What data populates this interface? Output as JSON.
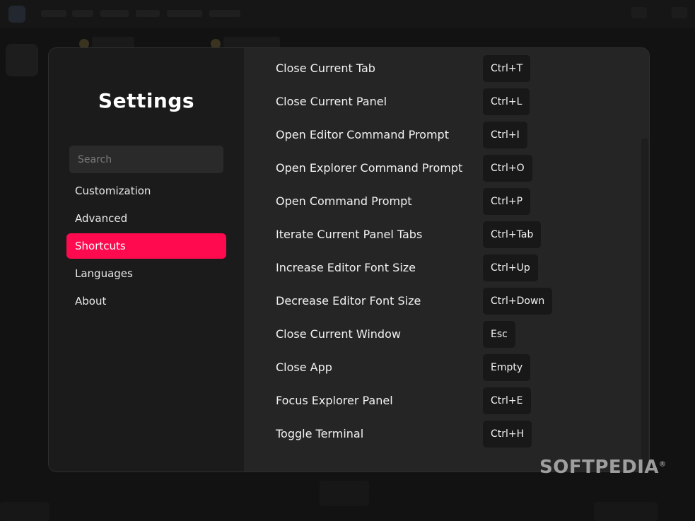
{
  "sidebar": {
    "title": "Settings",
    "search_placeholder": "Search",
    "items": [
      {
        "label": "Customization",
        "active": false
      },
      {
        "label": "Advanced",
        "active": false
      },
      {
        "label": "Shortcuts",
        "active": true
      },
      {
        "label": "Languages",
        "active": false
      },
      {
        "label": "About",
        "active": false
      }
    ]
  },
  "shortcuts": [
    {
      "label": "Close Current Tab",
      "key": "Ctrl+T"
    },
    {
      "label": "Close Current Panel",
      "key": "Ctrl+L"
    },
    {
      "label": "Open Editor Command Prompt",
      "key": "Ctrl+I"
    },
    {
      "label": "Open Explorer Command Prompt",
      "key": "Ctrl+O"
    },
    {
      "label": "Open Command Prompt",
      "key": "Ctrl+P"
    },
    {
      "label": "Iterate Current Panel Tabs",
      "key": "Ctrl+Tab"
    },
    {
      "label": "Increase Editor Font Size",
      "key": "Ctrl+Up"
    },
    {
      "label": "Decrease Editor Font Size",
      "key": "Ctrl+Down"
    },
    {
      "label": "Close Current Window",
      "key": "Esc"
    },
    {
      "label": "Close App",
      "key": "Empty"
    },
    {
      "label": "Focus Explorer Panel",
      "key": "Ctrl+E"
    },
    {
      "label": "Toggle Terminal",
      "key": "Ctrl+H"
    }
  ],
  "watermark": {
    "text": "SOFTPEDIA",
    "mark": "®"
  },
  "colors": {
    "accent": "#ff0a4f",
    "sidebar_bg": "#1b1b1b",
    "content_bg": "#252525",
    "key_chip_bg": "#181818"
  }
}
